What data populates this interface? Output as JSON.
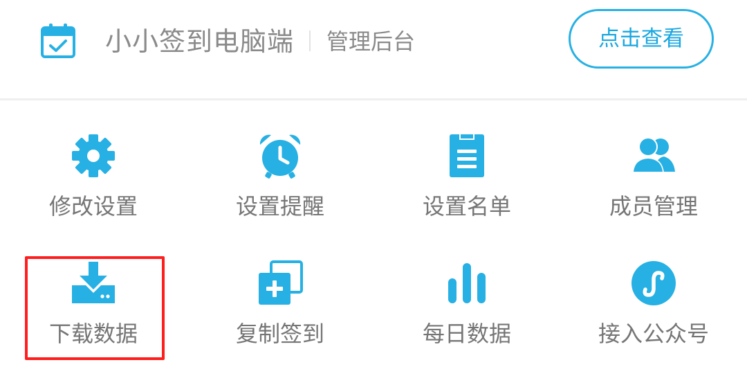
{
  "header": {
    "app_title": "小小签到电脑端",
    "subtitle": "管理后台",
    "view_button_label": "点击查看"
  },
  "colors": {
    "accent": "#1aa7e0",
    "icon_blue": "#27b0e3",
    "text_gray": "#757575",
    "highlight_red": "#ff1e1e"
  },
  "grid": {
    "items": [
      {
        "label": "修改设置",
        "icon": "gear-icon"
      },
      {
        "label": "设置提醒",
        "icon": "alarm-clock-icon"
      },
      {
        "label": "设置名单",
        "icon": "clipboard-list-icon"
      },
      {
        "label": "成员管理",
        "icon": "members-icon"
      },
      {
        "label": "下载数据",
        "icon": "download-icon"
      },
      {
        "label": "复制签到",
        "icon": "copy-add-icon"
      },
      {
        "label": "每日数据",
        "icon": "bar-chart-icon"
      },
      {
        "label": "接入公众号",
        "icon": "link-icon"
      }
    ]
  }
}
